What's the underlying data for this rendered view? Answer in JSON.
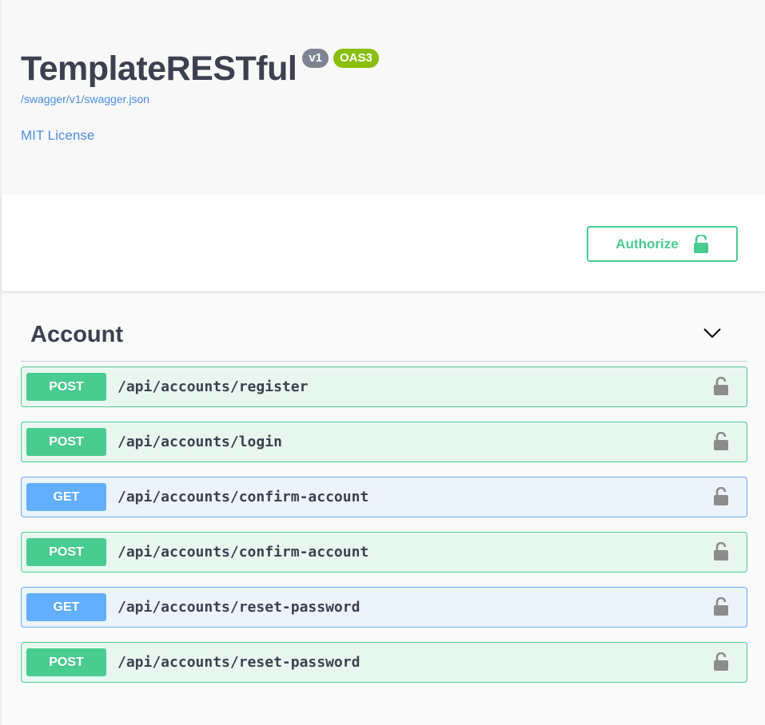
{
  "info": {
    "title": "TemplateRESTful",
    "version": "v1",
    "oas": "OAS3",
    "spec_url": "/swagger/v1/swagger.json",
    "license": "MIT License"
  },
  "authorize": {
    "label": "Authorize",
    "icon": "unlocked-padlock-icon"
  },
  "tag": {
    "name": "Account",
    "expanded": true
  },
  "operations": [
    {
      "method": "POST",
      "path": "/api/accounts/register"
    },
    {
      "method": "POST",
      "path": "/api/accounts/login"
    },
    {
      "method": "GET",
      "path": "/api/accounts/confirm-account"
    },
    {
      "method": "POST",
      "path": "/api/accounts/confirm-account"
    },
    {
      "method": "GET",
      "path": "/api/accounts/reset-password"
    },
    {
      "method": "POST",
      "path": "/api/accounts/reset-password"
    }
  ],
  "colors": {
    "post": "#49cc90",
    "get": "#61affe",
    "link": "#4990e2",
    "version_badge": "#7d8492",
    "oas_badge": "#89bf04"
  }
}
